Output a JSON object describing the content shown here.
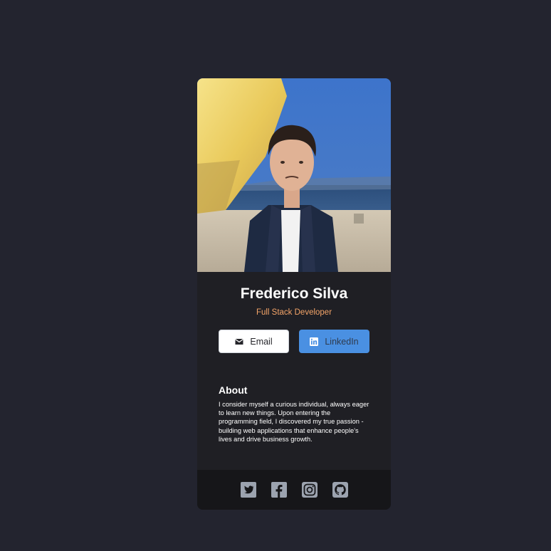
{
  "profile": {
    "name": "Frederico Silva",
    "role": "Full Stack Developer",
    "photo": "portrait-photo"
  },
  "buttons": {
    "email_label": "Email",
    "email_icon": "envelope-icon",
    "linkedin_label": "LinkedIn",
    "linkedin_icon": "linkedin-icon"
  },
  "about": {
    "title": "About",
    "text": "I consider myself a curious individual, always eager to learn new things. Upon entering the programming field, I discovered my true passion - building web applications that enhance people's lives and drive business growth."
  },
  "footer": {
    "icons": [
      "twitter-icon",
      "facebook-icon",
      "instagram-icon",
      "github-icon"
    ]
  },
  "colors": {
    "page_background": "#23242f",
    "card_background": "#1f1f24",
    "footer_background": "#161619",
    "accent_orange": "#f5a569",
    "linkedin_blue": "#4a90e2",
    "icon_gray": "#9ca3af"
  }
}
